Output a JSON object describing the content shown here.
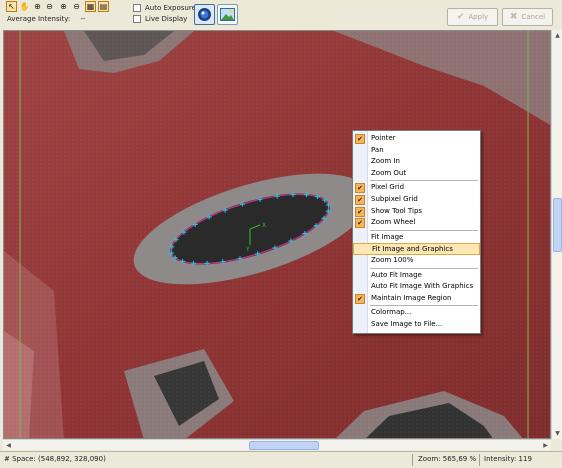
{
  "toolbar": {
    "tools": [
      {
        "name": "pointer-tool-button",
        "glyph": "↖",
        "active": true
      },
      {
        "name": "pan-tool-button",
        "glyph": "✋",
        "active": false
      },
      {
        "name": "zoom-in-tool-button",
        "glyph": "⊕",
        "active": false
      },
      {
        "name": "zoom-out-tool-button",
        "glyph": "⊖",
        "active": false
      },
      {
        "name": "zoom-fit-in-button",
        "glyph": "⊕",
        "active": false
      },
      {
        "name": "zoom-fit-out-button",
        "glyph": "⊖",
        "active": false
      },
      {
        "name": "grid-toggle-button",
        "glyph": "▦",
        "active": true
      },
      {
        "name": "subpixel-grid-toggle-button",
        "glyph": "▤",
        "active": true
      }
    ],
    "average_intensity_label": "Average Intensity:",
    "average_intensity_value": "--",
    "auto_exposure_label": "Auto Exposure",
    "live_display_label": "Live Display",
    "apply_label": "Apply",
    "cancel_label": "Cancel"
  },
  "context_menu": {
    "items": [
      {
        "label": "Pointer",
        "checked": true
      },
      {
        "label": "Pan",
        "checked": false
      },
      {
        "label": "Zoom In",
        "checked": false
      },
      {
        "label": "Zoom Out",
        "checked": false
      },
      {
        "separator": true
      },
      {
        "label": "Pixel Grid",
        "checked": true
      },
      {
        "label": "Subpixel Grid",
        "checked": true
      },
      {
        "label": "Show Tool Tips",
        "checked": true
      },
      {
        "label": "Zoom Wheel",
        "checked": true
      },
      {
        "separator": true
      },
      {
        "label": "Fit Image",
        "checked": false
      },
      {
        "label": "Fit Image and Graphics",
        "checked": false,
        "highlighted": true
      },
      {
        "label": "Zoom 100%",
        "checked": false
      },
      {
        "separator": true
      },
      {
        "label": "Auto Fit Image",
        "checked": false
      },
      {
        "label": "Auto Fit Image With Graphics",
        "checked": false
      },
      {
        "label": "Maintain Image Region",
        "checked": true
      },
      {
        "separator": true
      },
      {
        "label": "Colormap...",
        "checked": false
      },
      {
        "label": "Save Image to File...",
        "checked": false
      }
    ]
  },
  "status": {
    "space": "# Space: (548,892, 328,090)",
    "zoom": "Zoom: 565,69 %",
    "intensity": "Intensity: 119"
  },
  "colors": {
    "overlay_red": "#933636",
    "ellipse_outline": "#c03090",
    "crosshair": "#2ec02e",
    "edge_lines": "#7fb45a"
  }
}
